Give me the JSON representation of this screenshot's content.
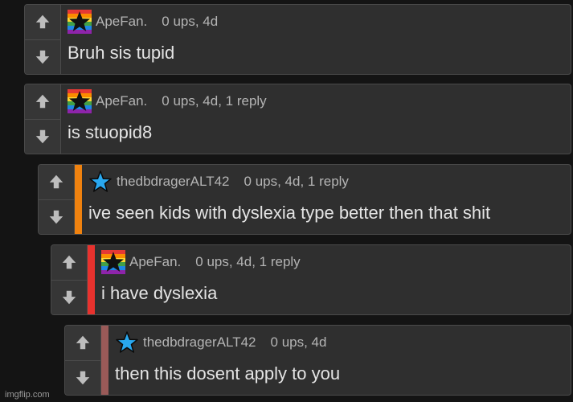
{
  "comments": [
    {
      "username": "ApeFan.",
      "meta": "0 ups, 4d",
      "body": "Bruh sis tupid",
      "avatar": "rainbow-star-icon",
      "stripe": ""
    },
    {
      "username": "ApeFan.",
      "meta": "0 ups, 4d, 1 reply",
      "body": "is stuopid8",
      "avatar": "rainbow-star-icon",
      "stripe": ""
    },
    {
      "username": "thedbdragerALT42",
      "meta": "0 ups, 4d, 1 reply",
      "body": "ive seen kids with dyslexia type better then that shit",
      "avatar": "blue-star-icon",
      "stripe": "#f0820f"
    },
    {
      "username": "ApeFan.",
      "meta": "0 ups, 4d, 1 reply",
      "body": "i have dyslexia",
      "avatar": "rainbow-star-icon",
      "stripe": "#e8322e"
    },
    {
      "username": "thedbdragerALT42",
      "meta": "0 ups, 4d",
      "body": "then this dosent apply to you",
      "avatar": "blue-star-icon",
      "stripe": "#9a5a58"
    }
  ],
  "watermark": "imgflip.com"
}
